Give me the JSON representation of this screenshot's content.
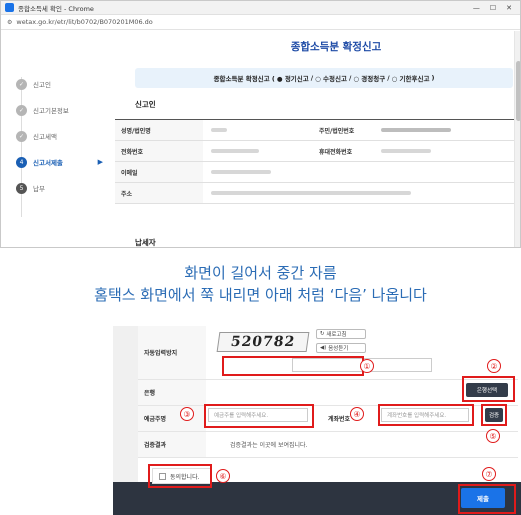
{
  "browser": {
    "title": "종합소득세 확인 - Chrome",
    "url": "wetax.go.kr/etr/lit/b0702/B070201M06.do",
    "controls": [
      "—",
      "☐",
      "✕"
    ]
  },
  "page": {
    "title": "종합소득분 확정신고",
    "banner": {
      "prefix": "종합소득분 확정신고 (",
      "options": [
        "● 정기신고",
        "○ 수정신고",
        "○ 경정청구",
        "○ 기한후신고"
      ],
      "suffix": ")"
    },
    "steps": [
      {
        "num": "✓",
        "label": "신고인",
        "state": "done"
      },
      {
        "num": "✓",
        "label": "신고기본정보",
        "state": "done"
      },
      {
        "num": "✓",
        "label": "신고세액",
        "state": "done"
      },
      {
        "num": "4",
        "label": "신고서제출",
        "state": "current"
      },
      {
        "num": "5",
        "label": "납부",
        "state": "todo"
      }
    ],
    "section_reporter": "신고인",
    "section_taxpayer": "납세자",
    "fields": {
      "name": "성명/법인명",
      "id": "주민/법인번호",
      "phone": "전화번호",
      "mobile": "휴대전화번호",
      "email": "이메일",
      "address": "주소"
    }
  },
  "caption": {
    "line1": "화면이 길어서 중간 자름",
    "line2": "홈택스 화면에서 쭉 내리면 아래 처럼 ‘다음’ 나옵니다"
  },
  "form": {
    "captcha_label": "자동입력방지",
    "captcha_text": "520782",
    "refresh_label": "새로고침",
    "audio_label": "음성듣기",
    "bank_label": "은행",
    "bank_select_button": "은행선택",
    "holder_label": "예금주명",
    "holder_placeholder": "예금주를 입력해주세요.",
    "account_label": "계좌번호",
    "account_placeholder": "계좌번호를 입력해주세요.",
    "verify_button": "검증",
    "result_label": "검증결과",
    "result_text": "검증결과는 이곳에 보여집니다.",
    "agree_label": "동의합니다.",
    "submit_button": "제출"
  },
  "marks": [
    "①",
    "②",
    "③",
    "④",
    "⑤",
    "⑥",
    "⑦"
  ],
  "colors": {
    "brand": "#1e4ba6",
    "annotation": "#e01b1b",
    "caption": "#2b6cb5",
    "submit": "#1a73e8"
  }
}
